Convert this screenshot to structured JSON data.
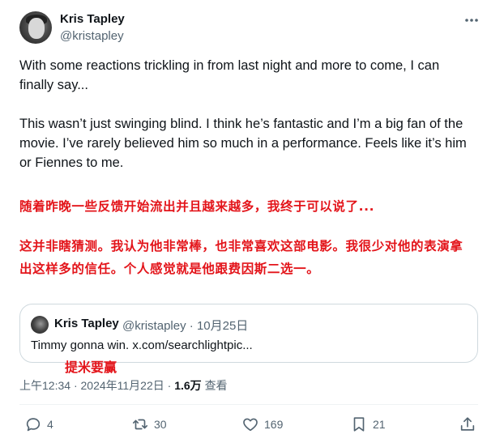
{
  "author": {
    "name": "Kris Tapley",
    "handle": "@kristapley"
  },
  "tweet": {
    "line1": "With some reactions trickling in from last night and more to come, I can finally say...",
    "line2": "This wasn’t just swinging blind. I think he’s fantastic and I’m a big fan of the movie. I’ve rarely believed him so much in a performance.  Feels like it’s him or Fiennes to me.",
    "translation1": "随着昨晚一些反馈开始流出并且越来越多，我终于可以说了...",
    "translation2": "这并非瞎猜测。我认为他非常棒，也非常喜欢这部电影。我很少对他的表演拿出这样多的信任。个人感觉就是他跟费因斯二选一。"
  },
  "quote": {
    "name": "Kris Tapley",
    "handle": "@kristapley",
    "separator": "·",
    "date": "10月25日",
    "text": "Timmy gonna win. x.com/searchlightpic...",
    "translation": "提米要赢"
  },
  "meta": {
    "time": "上午12:34",
    "dot1": "·",
    "date": "2024年11月22日",
    "dot2": "·",
    "views": "1.6万",
    "views_label": "查看"
  },
  "actions": {
    "replies": "4",
    "retweets": "30",
    "likes": "169",
    "bookmarks": "21"
  },
  "icons": [
    "more-icon",
    "reply-icon",
    "retweet-icon",
    "like-icon",
    "bookmark-icon",
    "share-icon"
  ],
  "colors": {
    "text": "#0f1419",
    "muted": "#536471",
    "translation": "#e3141a",
    "border": "#cfd9de"
  }
}
